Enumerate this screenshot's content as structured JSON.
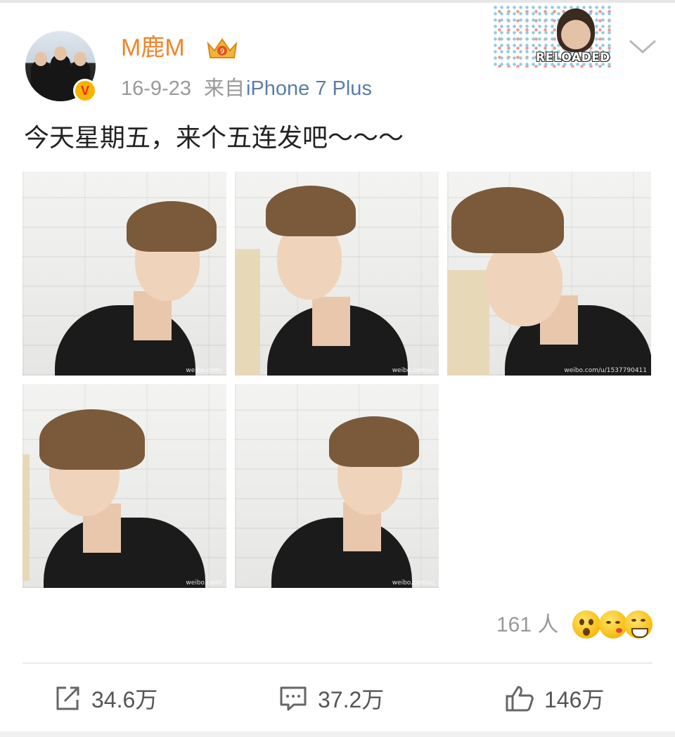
{
  "post": {
    "username": "M鹿M",
    "date": "16-9-23",
    "from_label": "来自",
    "source": "iPhone 7 Plus",
    "text": "今天星期五，来个五连发吧～～～",
    "badge_text": "RELOADED",
    "photos": [
      {
        "watermark": "weibo.com/"
      },
      {
        "watermark": "weibo.com/u/"
      },
      {
        "watermark": "weibo.com/u/1537790411"
      },
      {
        "watermark": "weibo.com/"
      },
      {
        "watermark": "weibo.com/u/"
      }
    ]
  },
  "reactions": {
    "count_label": "161 人",
    "emojis": [
      "surprised-emoji",
      "blowing-kiss-emoji",
      "grinning-emoji"
    ]
  },
  "actions": {
    "repost": "34.6万",
    "comment": "37.2万",
    "like": "146万"
  },
  "colors": {
    "username": "#f0842a",
    "source_link": "#5b7ea8",
    "meta": "#999999",
    "text": "#222222"
  }
}
